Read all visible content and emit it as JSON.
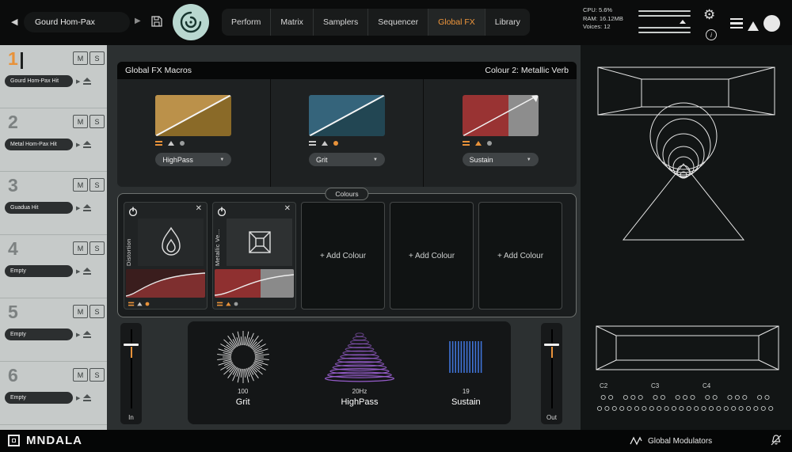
{
  "icons": {
    "back": "◀",
    "next": "▶",
    "gear": "⚙",
    "info": "i",
    "close": "✕",
    "chevron_down": "▼"
  },
  "colors": {
    "accent": "#e8923a",
    "logo_teal": "#b9d8d0",
    "purple": "#9a5fd0",
    "blue": "#3f74d8",
    "red": "#9c3434",
    "gold": "#b08a3c",
    "steel": "#2f5d72"
  },
  "topbar": {
    "preset_name": "Gourd Hom-Pax",
    "tabs": [
      "Perform",
      "Matrix",
      "Samplers",
      "Sequencer",
      "Global FX",
      "Library"
    ],
    "active_tab": "Global FX",
    "stats": {
      "cpu": "CPU: 5.6%",
      "ram": "RAM: 16.12MB",
      "voices": "Voices: 12"
    }
  },
  "sidebar": {
    "mute": "M",
    "solo": "S",
    "slots": [
      {
        "number": "1",
        "name": "Gourd Hom-Pax Hit"
      },
      {
        "number": "2",
        "name": "Metal Hom-Pax Hit"
      },
      {
        "number": "3",
        "name": "Guadua Hit"
      },
      {
        "number": "4",
        "name": "Empty"
      },
      {
        "number": "5",
        "name": "Empty"
      },
      {
        "number": "6",
        "name": "Empty"
      }
    ]
  },
  "macros": {
    "title": "Global FX Macros",
    "subtitle": "Colour 2: Metallic Verb",
    "items": [
      {
        "param": "HighPass"
      },
      {
        "param": "Grit"
      },
      {
        "param": "Sustain"
      }
    ]
  },
  "colours": {
    "title": "Colours",
    "cards": [
      {
        "name": "Distortion"
      },
      {
        "name": "Metallic Ve..."
      }
    ],
    "add_label": "+ Add Colour"
  },
  "mixer": {
    "in_label": "In",
    "out_label": "Out"
  },
  "fx_controls": [
    {
      "value": "100",
      "label": "Grit"
    },
    {
      "value": "20Hz",
      "label": "HighPass"
    },
    {
      "value": "19",
      "label": "Sustain"
    }
  ],
  "right_panel": {
    "octaves": [
      "C2",
      "C3",
      "C4"
    ]
  },
  "footer": {
    "brand": "MNDALA",
    "modulators": "Global Modulators"
  }
}
